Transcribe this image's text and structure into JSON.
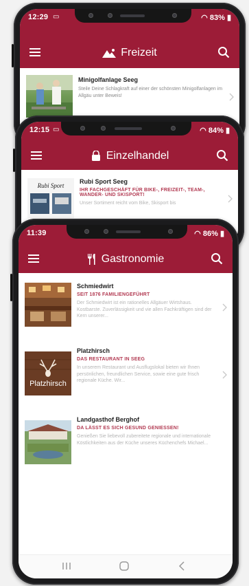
{
  "colors": {
    "accent": "#9c1c37",
    "subtitle": "#b23a52"
  },
  "phones": {
    "back": {
      "time": "12:29",
      "battery": "83%",
      "title": "Freizeit",
      "title_icon": "mountain-icon",
      "item": {
        "name": "Minigolfanlage Seeg",
        "desc": "Steile Deine Schlagkraft auf einer der schönsten Minigolfanlagen im Allgäu unter Beweis!"
      }
    },
    "middle": {
      "time": "12:15",
      "battery": "84%",
      "title": "Einzelhandel",
      "title_icon": "shopping-bag-icon",
      "item": {
        "name": "Rubi Sport Seeg",
        "subtitle": "IHR FACHGESCHÄFT FÜR BIKE-, FREIZEIT-, TEAM-, WANDER- UND SKISPORT!",
        "desc": "Unser Sortiment reicht vom Bike, Skisport bis"
      }
    },
    "front": {
      "time": "11:39",
      "battery": "86%",
      "title": "Gastronomie",
      "title_icon": "cutlery-icon",
      "items": [
        {
          "name": "Schmiedwirt",
          "subtitle": "SEIT 1876 FAMILIENGEFÜHRT",
          "desc": "Der Schmiedwirt ist ein rationelles Allgäuer Wirtshaus. Kostbarste. Zuverlässigkeit und vie allen Fachkräftigen sind der Kern unserer..."
        },
        {
          "name": "Platzhirsch",
          "subtitle": "DAS RESTAURANT IN SEEG",
          "desc": "In unserem Restaurant und Ausflugslokal bieten wir Ihnen persönlichen, freundlichen Service, sowie eine gute frisch regionale Küche. Wir..."
        },
        {
          "name": "Landgasthof Berghof",
          "subtitle": "DA LÄSST ES SICH GESUND GENIESSEN!",
          "desc": "Genießen Sie liebevoll zubereitete regionale und internationale Köstlichkeiten aus der Küche unseres Küchenchefs Michael..."
        }
      ],
      "thumb_text": "Platzhirsch"
    }
  }
}
